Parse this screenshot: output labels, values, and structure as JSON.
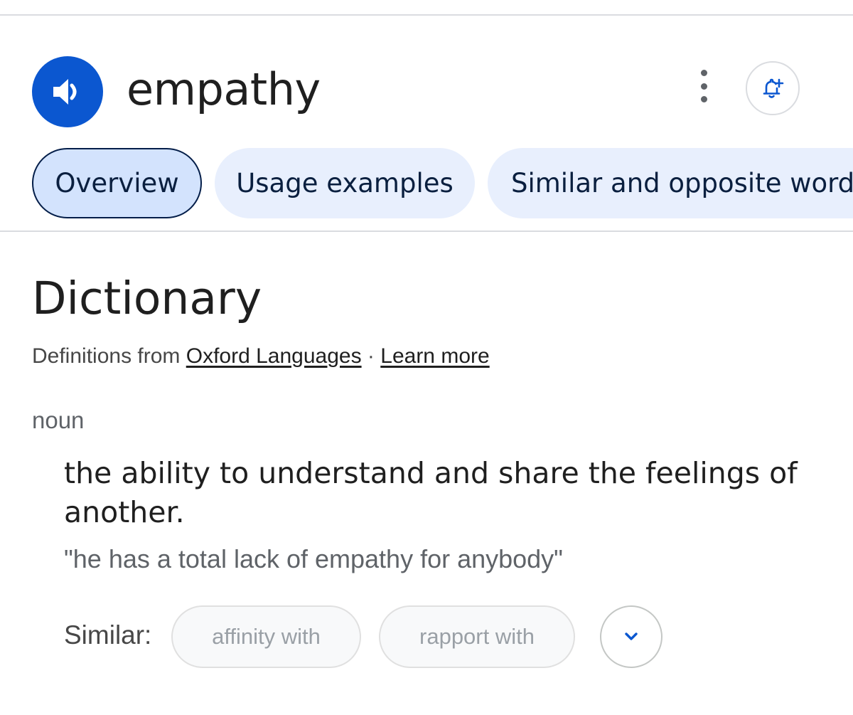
{
  "header": {
    "word": "empathy"
  },
  "tabs": [
    {
      "label": "Overview",
      "active": true
    },
    {
      "label": "Usage examples",
      "active": false
    },
    {
      "label": "Similar and opposite words",
      "active": false
    }
  ],
  "dictionary": {
    "title": "Dictionary",
    "source_prefix": "Definitions from ",
    "source_link": "Oxford Languages",
    "separator": " · ",
    "learn_more": "Learn more"
  },
  "entry": {
    "part_of_speech": "noun",
    "definition": "the ability to understand and share the feelings of another.",
    "example": "\"he has a total lack of empathy for anybody\"",
    "similar_label": "Similar:",
    "similar_words": [
      "affinity with",
      "rapport with"
    ]
  },
  "icons": {
    "speaker": "speaker-icon",
    "more": "more-vert-icon",
    "alert": "add-alert-icon",
    "expand": "chevron-down-icon"
  },
  "colors": {
    "accent": "#0b57d0",
    "tab_bg": "#e8effd",
    "tab_active_bg": "#d3e3fd",
    "tab_active_border": "#041e49"
  }
}
